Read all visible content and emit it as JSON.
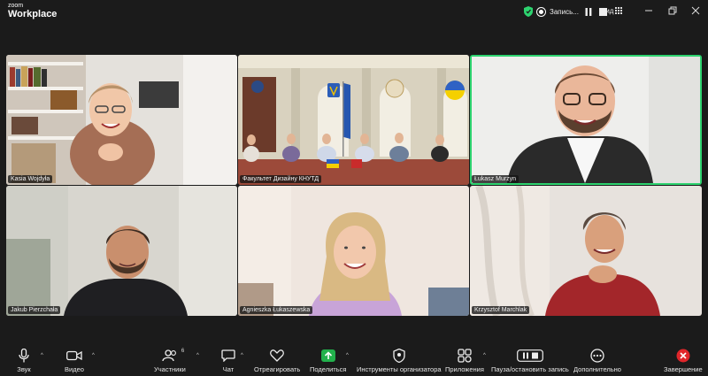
{
  "app": {
    "brand_small": "zoom",
    "brand_big": "Workplace"
  },
  "header": {
    "recording_label": "Запись...",
    "view_label": "Вид"
  },
  "tiles": [
    {
      "name": "Kasia Wojdyła"
    },
    {
      "name": "Факультет Дизайну КНУТД"
    },
    {
      "name": "Łukasz Murzyn"
    },
    {
      "name": "Jakub Pierzchała"
    },
    {
      "name": "Agnieszka Łukaszewska"
    },
    {
      "name": "Krzysztof Marchlak"
    }
  ],
  "toolbar": {
    "audio": "Звук",
    "video": "Видео",
    "participants": "Участники",
    "participants_count": "6",
    "chat": "Чат",
    "react": "Отреагировать",
    "share": "Поделиться",
    "host_tools": "Инструменты организатора",
    "apps": "Приложения",
    "pause_recording": "Пауза/остановить запись",
    "more": "Дополнительно",
    "end": "Завершение"
  },
  "colors": {
    "active_speaker": "#2dd36f",
    "share_green": "#22b14c",
    "end_red": "#e0262b",
    "background": "#1b1b1b"
  },
  "icons": [
    "shield-icon",
    "record-icon",
    "pause-icon",
    "stop-icon",
    "grid-icon",
    "minimize-icon",
    "restore-icon",
    "close-icon",
    "mic-icon",
    "camera-icon",
    "participants-icon",
    "chat-icon",
    "heart-icon",
    "share-arrow-icon",
    "shield-host-icon",
    "apps-icon",
    "pause-stop-icon",
    "more-icon",
    "end-x-icon"
  ]
}
